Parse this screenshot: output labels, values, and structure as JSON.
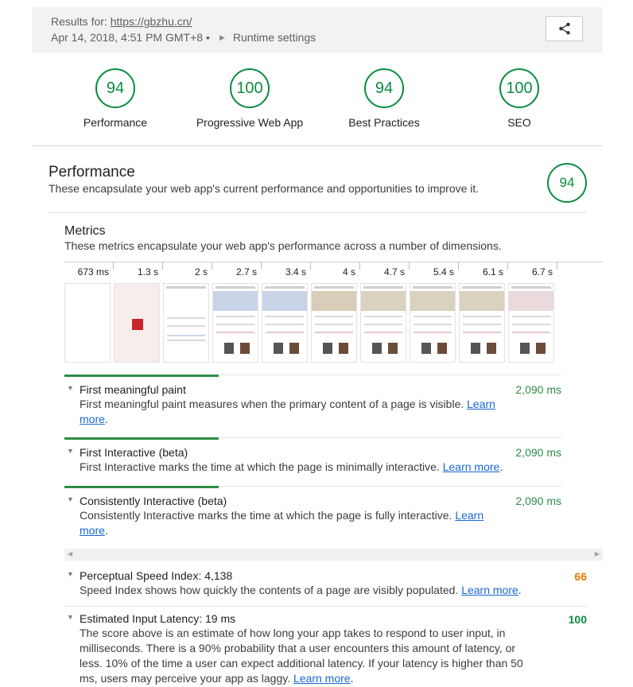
{
  "header": {
    "results_prefix": "Results for: ",
    "url": "https://gbzhu.cn/",
    "datetime": "Apr 14, 2018, 4:51 PM GMT+8",
    "dot": "•",
    "runtime_settings": "Runtime settings",
    "share_icon": "share-icon"
  },
  "gauges": [
    {
      "score": "94",
      "label": "Performance"
    },
    {
      "score": "100",
      "label": "Progressive Web App"
    },
    {
      "score": "94",
      "label": "Best Practices"
    },
    {
      "score": "100",
      "label": "SEO"
    }
  ],
  "performance": {
    "title": "Performance",
    "description": "These encapsulate your web app's current performance and opportunities to improve it.",
    "score": "94"
  },
  "metrics": {
    "title": "Metrics",
    "description": "These metrics encapsulate your web app's performance across a number of dimensions."
  },
  "filmstrip": [
    "673 ms",
    "1.3 s",
    "2 s",
    "2.7 s",
    "3.4 s",
    "4 s",
    "4.7 s",
    "5.4 s",
    "6.1 s",
    "6.7 s"
  ],
  "audits": [
    {
      "title": "First meaningful paint",
      "desc": "First meaningful paint measures when the primary content of a page is visible.",
      "link": "Learn more",
      "value": "2,090 ms"
    },
    {
      "title": "First Interactive (beta)",
      "desc": "First Interactive marks the time at which the page is minimally interactive.",
      "link": "Learn more",
      "value": "2,090 ms"
    },
    {
      "title": "Consistently Interactive (beta)",
      "desc": "Consistently Interactive marks the time at which the page is fully interactive.",
      "link": "Learn more",
      "value": "2,090 ms"
    },
    {
      "title": "Perceptual Speed Index: 4,138",
      "desc": "Speed Index shows how quickly the contents of a page are visibly populated.",
      "link": "Learn more",
      "value": "66"
    },
    {
      "title": "Estimated Input Latency: 19 ms",
      "desc": "The score above is an estimate of how long your app takes to respond to user input, in milliseconds. There is a 90% probability that a user encounters this amount of latency, or less. 10% of the time a user can expect additional latency. If your latency is higher than 50 ms, users may perceive your app as laggy.",
      "link": "Learn more",
      "value": "100"
    }
  ],
  "colors": {
    "pass": "#0a8c3f",
    "average": "#e67700",
    "link": "#1967d2"
  }
}
